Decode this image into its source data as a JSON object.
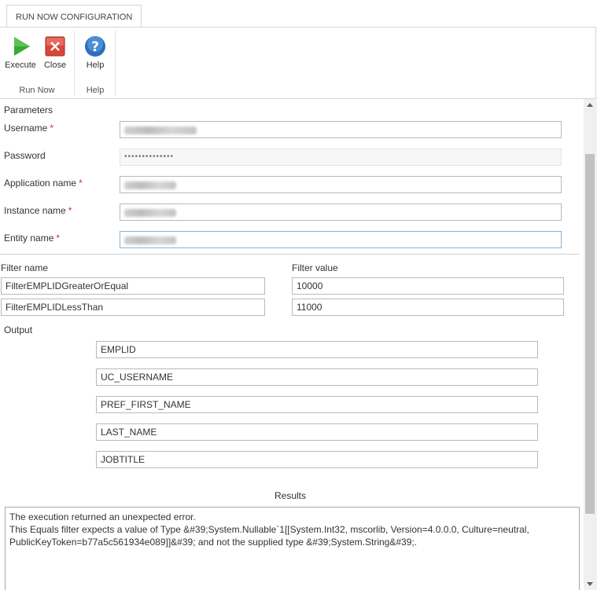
{
  "tab": {
    "label": "RUN NOW CONFIGURATION"
  },
  "ribbon": {
    "execute_label": "Execute",
    "close_label": "Close",
    "help_label": "Help",
    "group_run_now": "Run Now",
    "group_help": "Help"
  },
  "parameters": {
    "heading": "Parameters",
    "username_label": "Username",
    "password_label": "Password",
    "password_value": "••••••••••••••",
    "application_label": "Application name",
    "instance_label": "Instance name",
    "entity_label": "Entity name",
    "required_mark": "*"
  },
  "filters": {
    "name_header": "Filter name",
    "value_header": "Filter value",
    "rows": [
      {
        "name": "FilterEMPLIDGreaterOrEqual",
        "value": "10000"
      },
      {
        "name": "FilterEMPLIDLessThan",
        "value": "11000"
      }
    ]
  },
  "output": {
    "heading": "Output",
    "fields": [
      "EMPLID",
      "UC_USERNAME",
      "PREF_FIRST_NAME",
      "LAST_NAME",
      "JOBTITLE"
    ]
  },
  "results": {
    "heading": "Results",
    "text": "The execution returned an unexpected error.\nThis Equals filter expects a value of Type &#39;System.Nullable`1[[System.Int32, mscorlib, Version=4.0.0.0, Culture=neutral, PublicKeyToken=b77a5c561934e089]]&#39; and not the supplied type &#39;System.String&#39;."
  },
  "colors": {
    "accent_green": "#3aa935",
    "close_red": "#d9453a",
    "help_blue": "#2c6fb7",
    "required": "#cc3333"
  }
}
